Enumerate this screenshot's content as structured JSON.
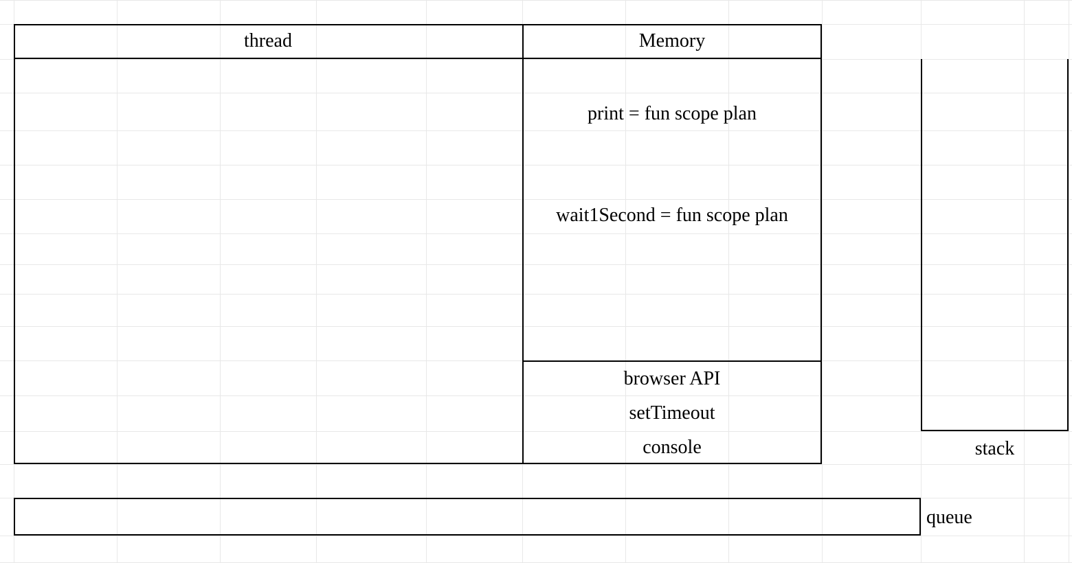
{
  "headers": {
    "thread": "thread",
    "memory": "Memory"
  },
  "memory_items": {
    "print": "print = fun scope plan",
    "wait1Second": "wait1Second = fun scope plan"
  },
  "browser_api": {
    "title": "browser API",
    "setTimeout": "setTimeout",
    "console": "console"
  },
  "stack": {
    "label": "stack"
  },
  "queue": {
    "label": "queue"
  }
}
